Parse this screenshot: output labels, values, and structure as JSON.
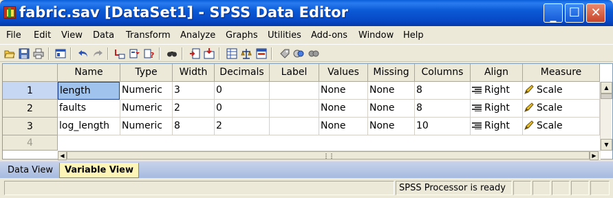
{
  "window": {
    "title": "fabric.sav [DataSet1] - SPSS Data Editor"
  },
  "menu": [
    "File",
    "Edit",
    "View",
    "Data",
    "Transform",
    "Analyze",
    "Graphs",
    "Utilities",
    "Add-ons",
    "Window",
    "Help"
  ],
  "toolbar_icons": [
    "open-icon",
    "save-icon",
    "print-icon",
    "dialog-recall-icon",
    "undo-icon",
    "redo-icon",
    "goto-case-icon",
    "variables-icon",
    "find-icon",
    "insert-cases-icon",
    "insert-variable-icon",
    "split-file-icon",
    "weight-cases-icon",
    "select-cases-icon",
    "value-labels-icon",
    "use-sets-icon",
    "show-all-icon"
  ],
  "grid": {
    "headers": [
      "Name",
      "Type",
      "Width",
      "Decimals",
      "Label",
      "Values",
      "Missing",
      "Columns",
      "Align",
      "Measure"
    ],
    "rows": [
      {
        "num": "1",
        "name": "length",
        "type": "Numeric",
        "width": "3",
        "decimals": "0",
        "label": "",
        "values": "None",
        "missing": "None",
        "columns": "8",
        "align": "Right",
        "measure": "Scale"
      },
      {
        "num": "2",
        "name": "faults",
        "type": "Numeric",
        "width": "2",
        "decimals": "0",
        "label": "",
        "values": "None",
        "missing": "None",
        "columns": "8",
        "align": "Right",
        "measure": "Scale"
      },
      {
        "num": "3",
        "name": "log_length",
        "type": "Numeric",
        "width": "8",
        "decimals": "2",
        "label": "",
        "values": "None",
        "missing": "None",
        "columns": "10",
        "align": "Right",
        "measure": "Scale"
      }
    ],
    "empty_row_num": "4"
  },
  "tabs": {
    "data_view": "Data View",
    "variable_view": "Variable View"
  },
  "status": {
    "processor": "SPSS  Processor is ready"
  },
  "colors": {
    "title_bar": "#0b5ad6",
    "selected_cell": "#9fc3ec",
    "active_tab": "#fdf5b8"
  }
}
